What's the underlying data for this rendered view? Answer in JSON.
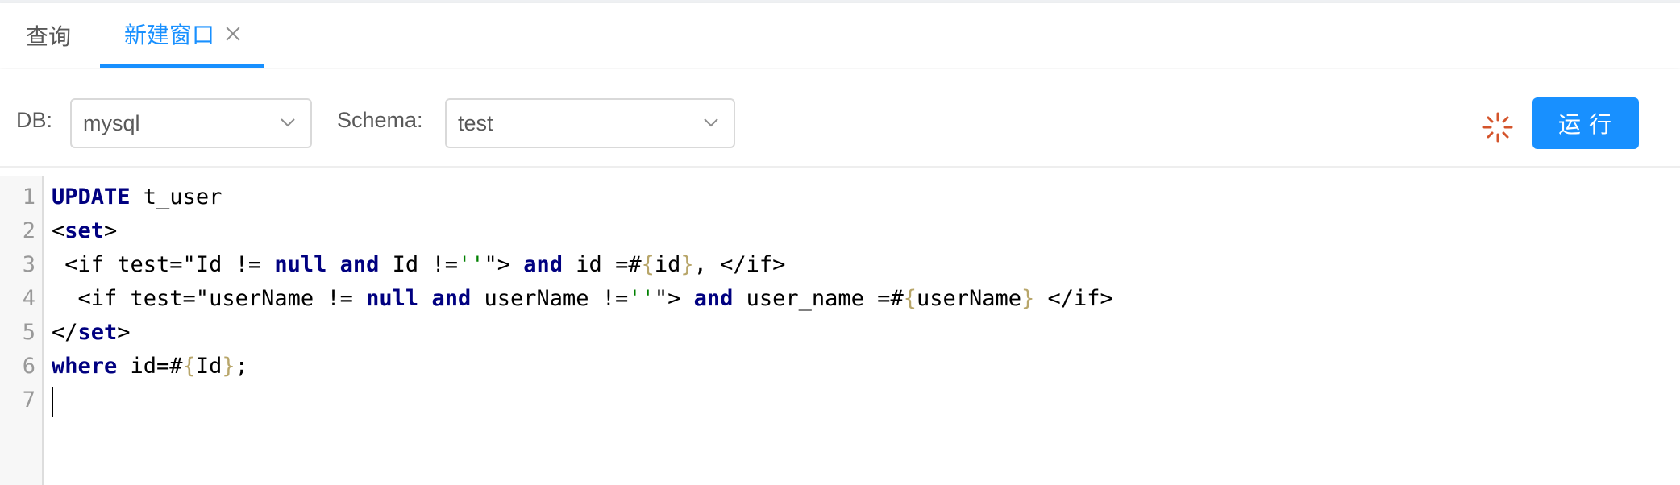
{
  "tabs": [
    {
      "label": "查询",
      "active": false
    },
    {
      "label": "新建窗口",
      "active": true,
      "closable": true
    }
  ],
  "toolbar": {
    "db_label": "DB:",
    "db_value": "mysql",
    "schema_label": "Schema:",
    "schema_value": "test",
    "run_label": "运行",
    "status_icon": "loading-spinner-icon"
  },
  "editor": {
    "line_numbers": [
      "1",
      "2",
      "3",
      "4",
      "5",
      "6",
      "7"
    ],
    "lines": [
      [
        {
          "t": "UPDATE",
          "c": "kw"
        },
        {
          "t": " t_user",
          "c": ""
        }
      ],
      [
        {
          "t": "<",
          "c": ""
        },
        {
          "t": "set",
          "c": "kw"
        },
        {
          "t": ">",
          "c": ""
        }
      ],
      [
        {
          "t": " <if test=\"Id != ",
          "c": ""
        },
        {
          "t": "null",
          "c": "kw"
        },
        {
          "t": " ",
          "c": ""
        },
        {
          "t": "and",
          "c": "kw"
        },
        {
          "t": " Id !=",
          "c": ""
        },
        {
          "t": "''",
          "c": "str"
        },
        {
          "t": "\"> ",
          "c": ""
        },
        {
          "t": "and",
          "c": "kw"
        },
        {
          "t": " id =#",
          "c": ""
        },
        {
          "t": "{",
          "c": "br"
        },
        {
          "t": "id",
          "c": ""
        },
        {
          "t": "}",
          "c": "br"
        },
        {
          "t": ", </if>",
          "c": ""
        }
      ],
      [
        {
          "t": "  <if test=\"userName != ",
          "c": ""
        },
        {
          "t": "null",
          "c": "kw"
        },
        {
          "t": " ",
          "c": ""
        },
        {
          "t": "and",
          "c": "kw"
        },
        {
          "t": " userName !=",
          "c": ""
        },
        {
          "t": "''",
          "c": "str"
        },
        {
          "t": "\"> ",
          "c": ""
        },
        {
          "t": "and",
          "c": "kw"
        },
        {
          "t": " user_name =#",
          "c": ""
        },
        {
          "t": "{",
          "c": "br"
        },
        {
          "t": "userName",
          "c": ""
        },
        {
          "t": "}",
          "c": "br"
        },
        {
          "t": " </if>",
          "c": ""
        }
      ],
      [
        {
          "t": "</",
          "c": ""
        },
        {
          "t": "set",
          "c": "kw"
        },
        {
          "t": ">",
          "c": ""
        }
      ],
      [
        {
          "t": "where",
          "c": "kw"
        },
        {
          "t": " id=#",
          "c": ""
        },
        {
          "t": "{",
          "c": "br"
        },
        {
          "t": "Id",
          "c": ""
        },
        {
          "t": "}",
          "c": "br"
        },
        {
          "t": ";",
          "c": ""
        }
      ],
      []
    ]
  },
  "colors": {
    "accent": "#1890ff",
    "keyword": "#000080",
    "string": "#008000",
    "brace": "#b8a66a",
    "spinner": "#d4542b"
  }
}
